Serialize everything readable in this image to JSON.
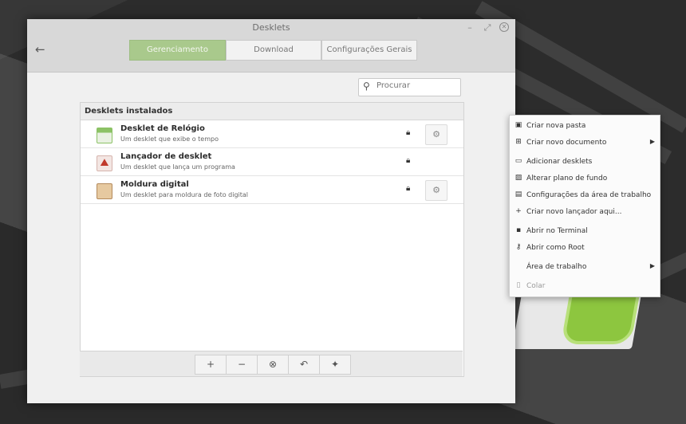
{
  "window": {
    "title": "Desklets",
    "controls": {
      "minimize": "–",
      "maximize": "⤢",
      "close": "✕"
    },
    "back_icon": "←"
  },
  "tabs": [
    "Gerenciamento",
    "Download",
    "Configurações Gerais"
  ],
  "search": {
    "placeholder": "Procurar"
  },
  "list": {
    "header": "Desklets instalados",
    "items": [
      {
        "name": "Desklet de Relógio",
        "desc": "Um desklet que exibe o tempo",
        "icon": "clock-desklet-icon",
        "configurable": true
      },
      {
        "name": "Lançador de desklet",
        "desc": "Um desklet que lança um programa",
        "icon": "launcher-desklet-icon",
        "configurable": false
      },
      {
        "name": "Moldura digital",
        "desc": "Um desklet para moldura de foto digital",
        "icon": "photo-frame-desklet-icon",
        "configurable": true
      }
    ]
  },
  "toolbar": {
    "add": "+",
    "remove": "−",
    "clear": "⊗",
    "undo": "↶",
    "more": "✦"
  },
  "context_menu": {
    "items": [
      {
        "label": "Criar nova pasta",
        "icon": "folder-new-icon",
        "submenu": false
      },
      {
        "label": "Criar novo documento",
        "icon": "document-new-icon",
        "submenu": true
      },
      {
        "label": "Adicionar desklets",
        "icon": "desklet-add-icon",
        "submenu": false
      },
      {
        "label": "Alterar plano de fundo",
        "icon": "wallpaper-icon",
        "submenu": false
      },
      {
        "label": "Configurações da área de trabalho",
        "icon": "desktop-settings-icon",
        "submenu": false
      },
      {
        "label": "Criar novo lançador aqui...",
        "icon": "plus-icon",
        "submenu": false
      },
      {
        "label": "Abrir no Terminal",
        "icon": "terminal-icon",
        "submenu": false
      },
      {
        "label": "Abrir como Root",
        "icon": "key-icon",
        "submenu": false
      },
      {
        "label": "Área de trabalho",
        "icon": "",
        "submenu": true
      },
      {
        "label": "Colar",
        "icon": "paste-icon",
        "submenu": false,
        "disabled": true
      }
    ]
  },
  "colors": {
    "accent": "#a9c98c"
  }
}
